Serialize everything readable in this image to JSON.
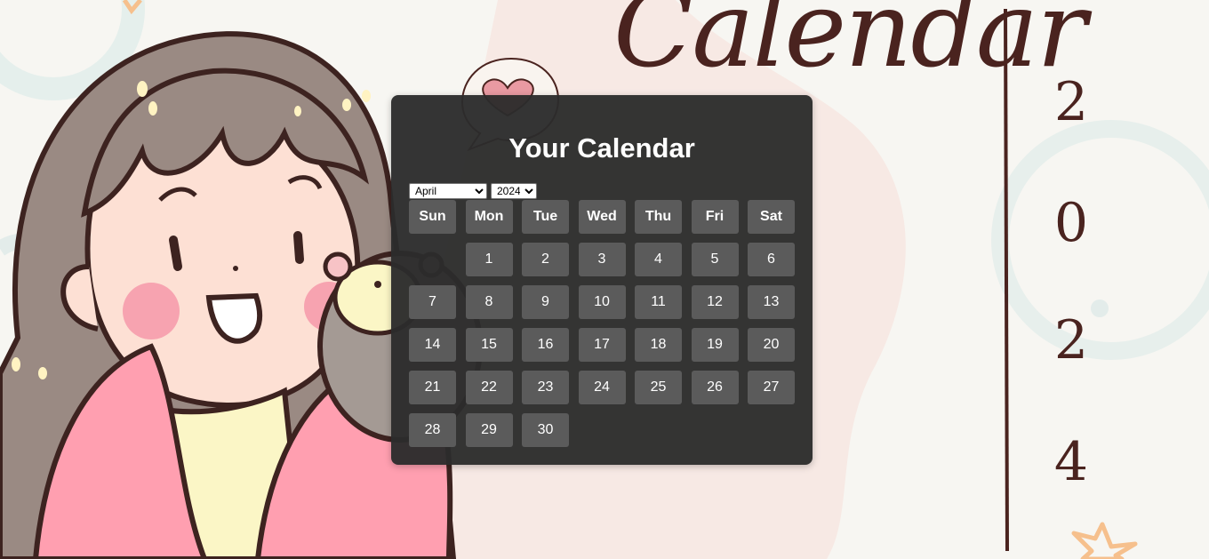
{
  "banner": {
    "script_title": "Calendar",
    "year_digits": [
      "2",
      "0",
      "2",
      "4"
    ]
  },
  "calendar": {
    "title": "Your Calendar",
    "selected_month": "April",
    "selected_year": "2024",
    "weekdays": [
      "Sun",
      "Mon",
      "Tue",
      "Wed",
      "Thu",
      "Fri",
      "Sat"
    ],
    "leading_blank_days": 1,
    "days": [
      "1",
      "2",
      "3",
      "4",
      "5",
      "6",
      "7",
      "8",
      "9",
      "10",
      "11",
      "12",
      "13",
      "14",
      "15",
      "16",
      "17",
      "18",
      "19",
      "20",
      "21",
      "22",
      "23",
      "24",
      "25",
      "26",
      "27",
      "28",
      "29",
      "30"
    ]
  },
  "colors": {
    "panel_bg": "#2c2c2c",
    "cell_bg": "#5b5b5b",
    "accent_brown": "#4a231f",
    "pink": "#ff9fb0",
    "skin": "#fde0d4"
  },
  "icons": [
    "speech-bubble-heart-icon",
    "star-icon"
  ]
}
